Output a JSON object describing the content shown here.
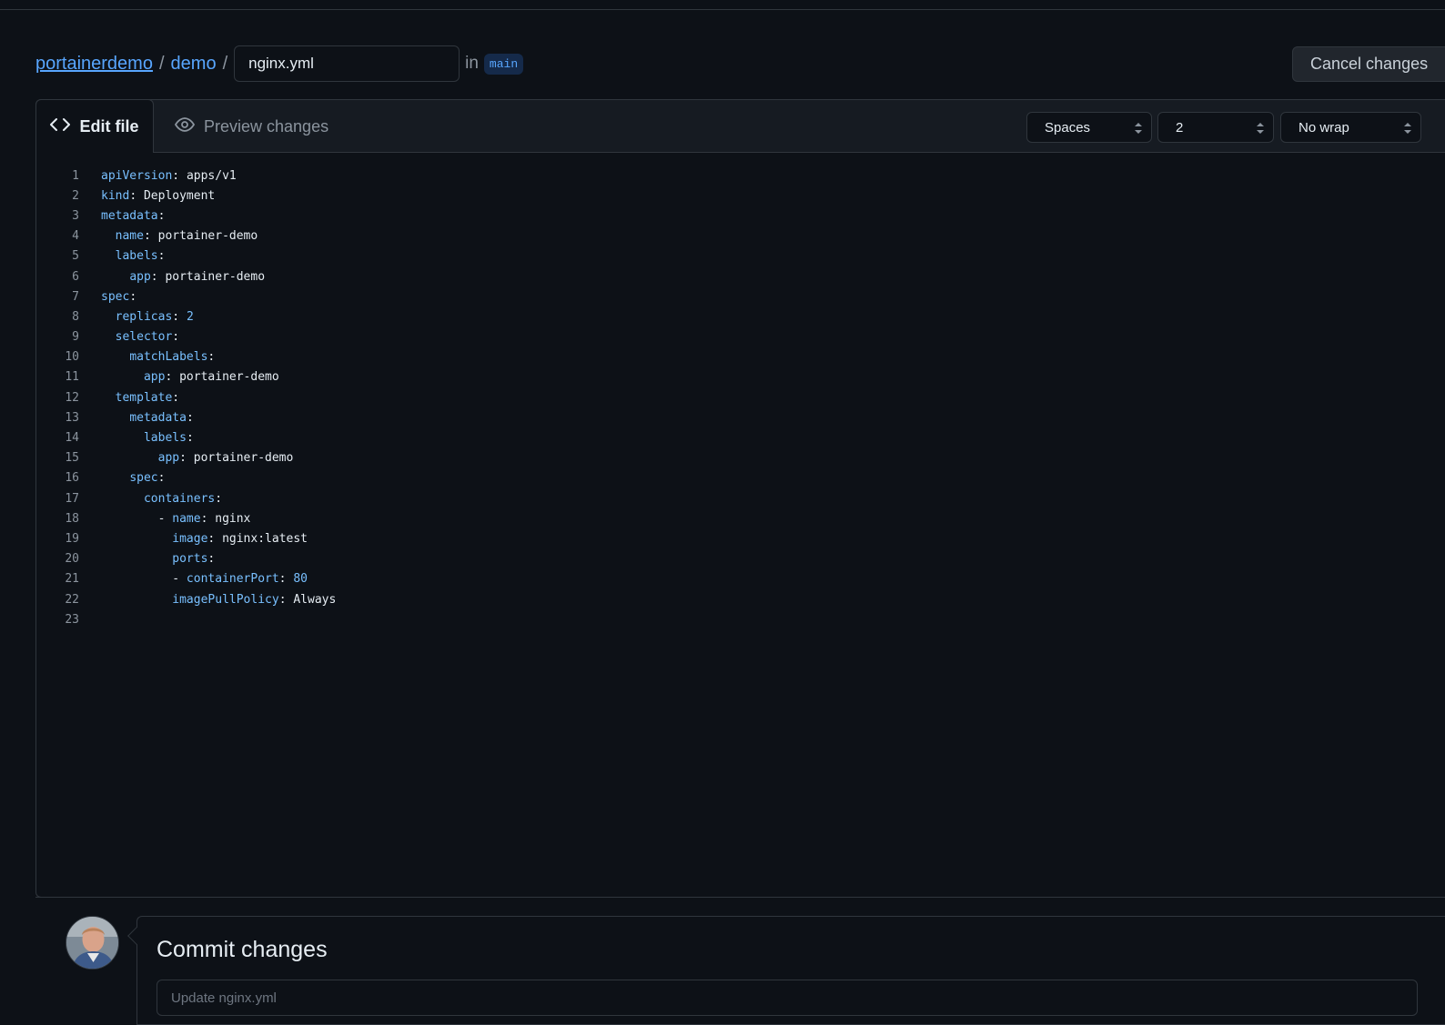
{
  "breadcrumb": {
    "owner": "portainerdemo",
    "repo": "demo",
    "separator": "/",
    "filename": "nginx.yml",
    "in_label": "in",
    "branch": "main"
  },
  "actions": {
    "cancel_label": "Cancel changes"
  },
  "editor": {
    "tabs": {
      "edit_label": "Edit file",
      "preview_label": "Preview changes"
    },
    "indent_mode": "Spaces",
    "indent_size": "2",
    "wrap_mode": "No wrap",
    "lines": [
      {
        "num": "1",
        "indent": "",
        "key": "apiVersion",
        "value": "apps/v1"
      },
      {
        "num": "2",
        "indent": "",
        "key": "kind",
        "value": "Deployment"
      },
      {
        "num": "3",
        "indent": "",
        "key": "metadata",
        "value": ""
      },
      {
        "num": "4",
        "indent": "  ",
        "key": "name",
        "value": "portainer-demo"
      },
      {
        "num": "5",
        "indent": "  ",
        "key": "labels",
        "value": ""
      },
      {
        "num": "6",
        "indent": "    ",
        "key": "app",
        "value": "portainer-demo"
      },
      {
        "num": "7",
        "indent": "",
        "key": "spec",
        "value": ""
      },
      {
        "num": "8",
        "indent": "  ",
        "key": "replicas",
        "value": "2",
        "numeric": true
      },
      {
        "num": "9",
        "indent": "  ",
        "key": "selector",
        "value": ""
      },
      {
        "num": "10",
        "indent": "    ",
        "key": "matchLabels",
        "value": ""
      },
      {
        "num": "11",
        "indent": "      ",
        "key": "app",
        "value": "portainer-demo"
      },
      {
        "num": "12",
        "indent": "  ",
        "key": "template",
        "value": ""
      },
      {
        "num": "13",
        "indent": "    ",
        "key": "metadata",
        "value": ""
      },
      {
        "num": "14",
        "indent": "      ",
        "key": "labels",
        "value": ""
      },
      {
        "num": "15",
        "indent": "        ",
        "key": "app",
        "value": "portainer-demo"
      },
      {
        "num": "16",
        "indent": "    ",
        "key": "spec",
        "value": ""
      },
      {
        "num": "17",
        "indent": "      ",
        "key": "containers",
        "value": ""
      },
      {
        "num": "18",
        "indent": "        - ",
        "key": "name",
        "value": "nginx"
      },
      {
        "num": "19",
        "indent": "          ",
        "key": "image",
        "value": "nginx:latest"
      },
      {
        "num": "20",
        "indent": "          ",
        "key": "ports",
        "value": ""
      },
      {
        "num": "21",
        "indent": "          - ",
        "key": "containerPort",
        "value": "80",
        "numeric": true
      },
      {
        "num": "22",
        "indent": "          ",
        "key": "imagePullPolicy",
        "value": "Always"
      },
      {
        "num": "23",
        "indent": "",
        "key": "",
        "value": ""
      }
    ]
  },
  "commit": {
    "title": "Commit changes",
    "message_placeholder": "Update nginx.yml"
  },
  "colors": {
    "background": "#0d1117",
    "link": "#58a6ff",
    "yaml_key": "#79c0ff",
    "border": "#30363d"
  },
  "icons": {
    "edit_tab": "code-icon",
    "preview_tab": "eye-icon",
    "select_arrows": "sort-arrows-icon"
  }
}
